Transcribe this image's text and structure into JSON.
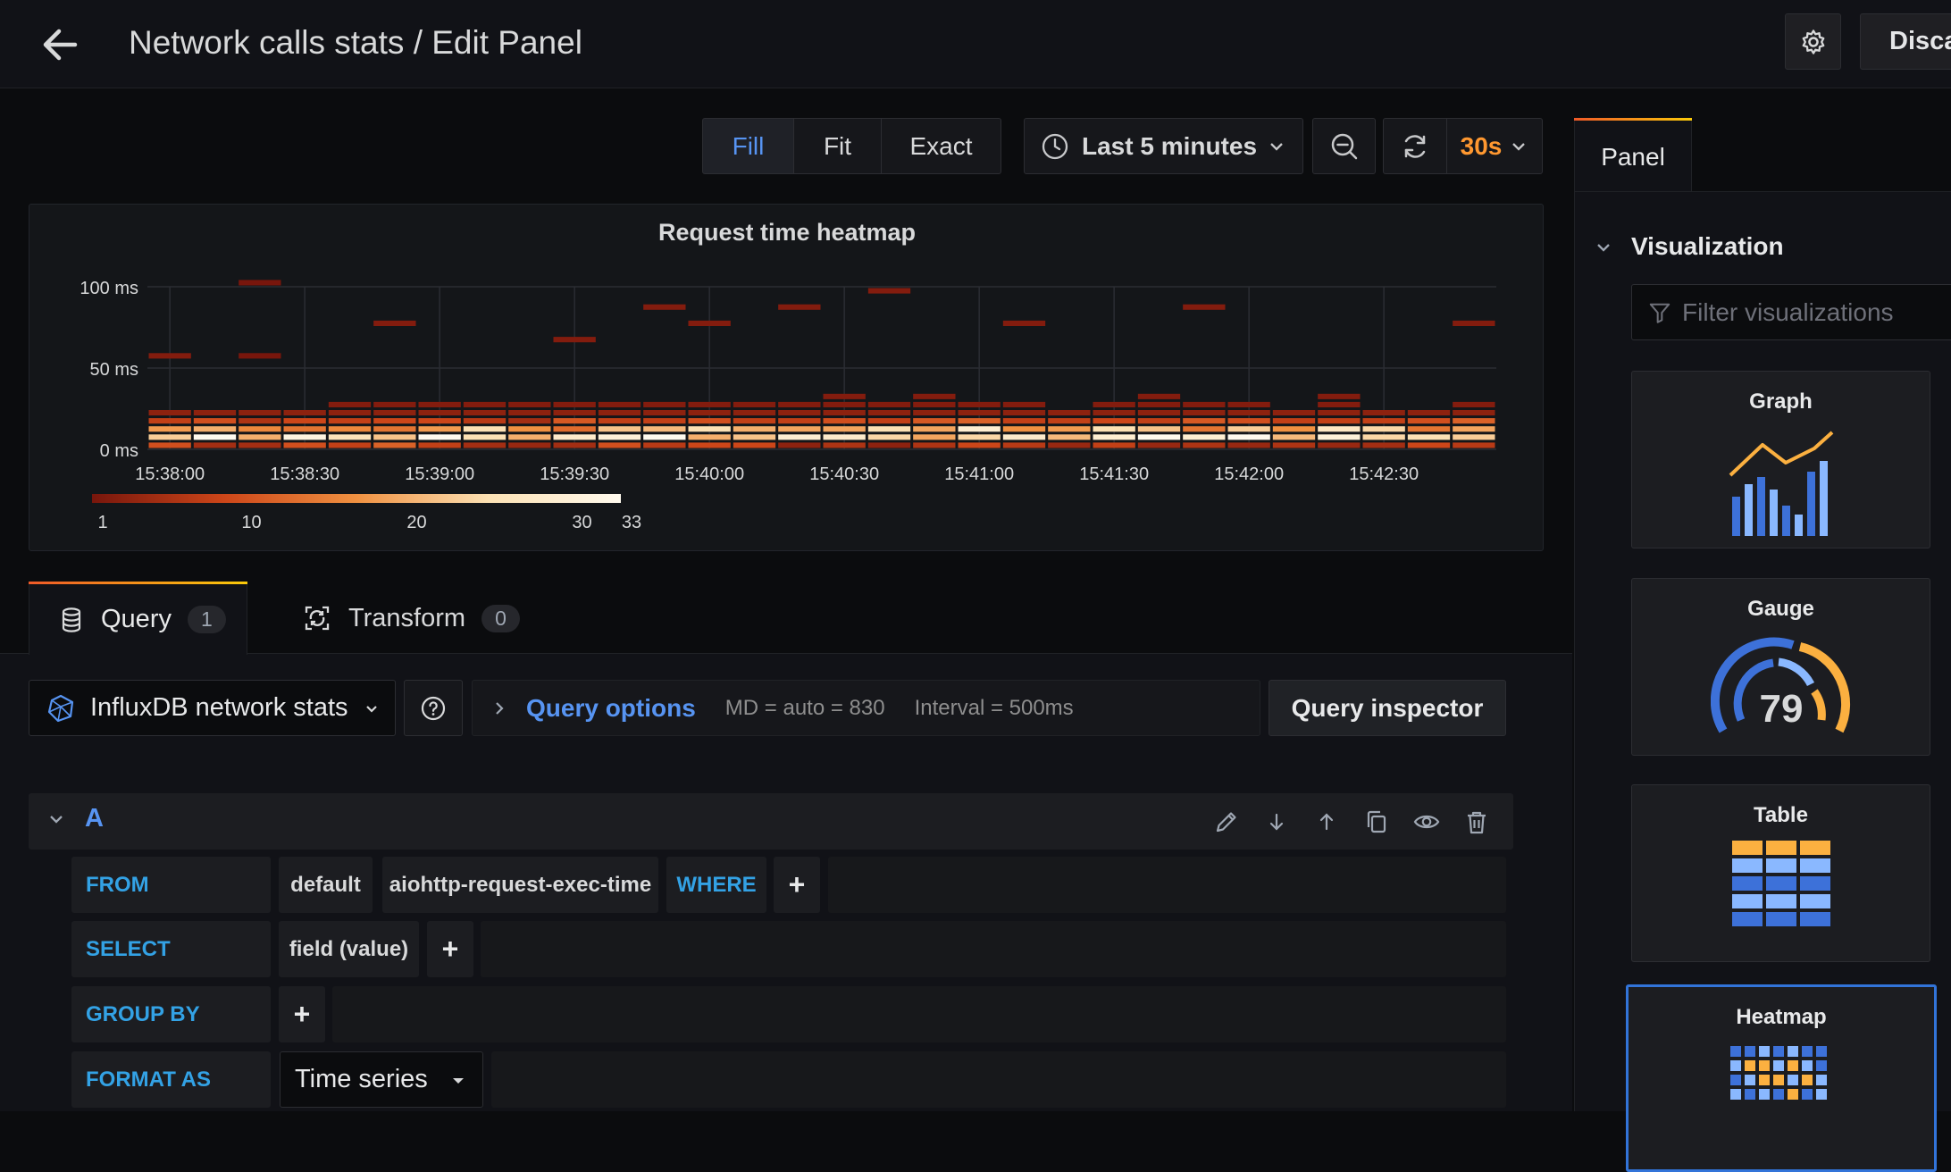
{
  "header": {
    "title": "Network calls stats / Edit Panel",
    "discard_label": "Disca"
  },
  "toolbar": {
    "fill": "Fill",
    "fit": "Fit",
    "exact": "Exact",
    "time_range": "Last 5 minutes",
    "refresh_interval": "30s"
  },
  "chart_data": {
    "type": "heatmap",
    "title": "Request time heatmap",
    "y_ticks": [
      "100 ms",
      "50 ms",
      "0 ms"
    ],
    "x_ticks": [
      "15:38:00",
      "15:38:30",
      "15:39:00",
      "15:39:30",
      "15:40:00",
      "15:40:30",
      "15:41:00",
      "15:41:30",
      "15:42:00",
      "15:42:30"
    ],
    "legend_ticks": [
      "1",
      "10",
      "20",
      "30",
      "33"
    ],
    "color_range": [
      1,
      33
    ],
    "bucket_size_ms": 5,
    "columns": [
      {
        "buckets": {
          "0": 10,
          "1": 23,
          "2": 18,
          "3": 8,
          "4": 3,
          "11": 2
        }
      },
      {
        "buckets": {
          "0": 5,
          "1": 33,
          "2": 20,
          "3": 10,
          "4": 3
        }
      },
      {
        "buckets": {
          "0": 5,
          "1": 20,
          "2": 16,
          "3": 6,
          "4": 3,
          "11": 1,
          "20": 1
        }
      },
      {
        "buckets": {
          "0": 10,
          "1": 31,
          "2": 14,
          "3": 9,
          "4": 3
        }
      },
      {
        "buckets": {
          "0": 8,
          "1": 26,
          "2": 16,
          "3": 8,
          "4": 3,
          "5": 2
        }
      },
      {
        "buckets": {
          "0": 12,
          "1": 22,
          "2": 14,
          "3": 9,
          "4": 3,
          "5": 2,
          "15": 2
        }
      },
      {
        "buckets": {
          "0": 8,
          "1": 33,
          "2": 18,
          "3": 9,
          "4": 3,
          "5": 2
        }
      },
      {
        "buckets": {
          "0": 5,
          "1": 25,
          "2": 25,
          "3": 7,
          "4": 3,
          "5": 2
        }
      },
      {
        "buckets": {
          "0": 4,
          "1": 20,
          "2": 17,
          "3": 5,
          "4": 3,
          "5": 2
        }
      },
      {
        "buckets": {
          "0": 5,
          "1": 28,
          "2": 13,
          "3": 11,
          "4": 3,
          "5": 2,
          "13": 2
        }
      },
      {
        "buckets": {
          "0": 10,
          "1": 30,
          "2": 22,
          "3": 8,
          "4": 3,
          "5": 2
        }
      },
      {
        "buckets": {
          "0": 7,
          "1": 33,
          "2": 21,
          "3": 8,
          "4": 3,
          "5": 2,
          "17": 2
        }
      },
      {
        "buckets": {
          "0": 9,
          "1": 20,
          "2": 25,
          "3": 10,
          "4": 3,
          "5": 2,
          "15": 2
        }
      },
      {
        "buckets": {
          "0": 9,
          "1": 22,
          "2": 20,
          "3": 8,
          "4": 3,
          "5": 2
        }
      },
      {
        "buckets": {
          "0": 3,
          "1": 29,
          "2": 19,
          "3": 8,
          "4": 3,
          "5": 2,
          "17": 2
        }
      },
      {
        "buckets": {
          "0": 6,
          "1": 28,
          "2": 19,
          "3": 10,
          "4": 3,
          "5": 2,
          "6": 2
        }
      },
      {
        "buckets": {
          "0": 3,
          "1": 24,
          "2": 25,
          "3": 8,
          "4": 3,
          "5": 2,
          "19": 2
        }
      },
      {
        "buckets": {
          "0": 6,
          "1": 19,
          "2": 19,
          "3": 11,
          "4": 3,
          "5": 2,
          "6": 2
        }
      },
      {
        "buckets": {
          "0": 9,
          "1": 24,
          "2": 29,
          "3": 12,
          "4": 3,
          "5": 2
        }
      },
      {
        "buckets": {
          "0": 7,
          "1": 28,
          "2": 17,
          "3": 8,
          "4": 3,
          "5": 2,
          "15": 2
        }
      },
      {
        "buckets": {
          "0": 4,
          "1": 21,
          "2": 18,
          "3": 8,
          "4": 3
        }
      },
      {
        "buckets": {
          "0": 8,
          "1": 29,
          "2": 25,
          "3": 9,
          "4": 3,
          "5": 2
        }
      },
      {
        "buckets": {
          "0": 4,
          "1": 33,
          "2": 22,
          "3": 8,
          "4": 3,
          "5": 2,
          "6": 2
        }
      },
      {
        "buckets": {
          "0": 6,
          "1": 29,
          "2": 14,
          "3": 11,
          "4": 3,
          "5": 2,
          "17": 2
        }
      },
      {
        "buckets": {
          "0": 4,
          "1": 33,
          "2": 23,
          "3": 10,
          "4": 3,
          "5": 2
        }
      },
      {
        "buckets": {
          "0": 6,
          "1": 21,
          "2": 17,
          "3": 8,
          "4": 3
        }
      },
      {
        "buckets": {
          "0": 4,
          "1": 30,
          "2": 27,
          "3": 8,
          "4": 3,
          "5": 2,
          "6": 2
        }
      },
      {
        "buckets": {
          "0": 5,
          "1": 24,
          "2": 24,
          "3": 8,
          "4": 3
        }
      },
      {
        "buckets": {
          "0": 9,
          "1": 25,
          "2": 14,
          "3": 10,
          "4": 3
        }
      },
      {
        "buckets": {
          "0": 7,
          "1": 23,
          "2": 19,
          "3": 12,
          "4": 3,
          "5": 2,
          "15": 2
        }
      }
    ]
  },
  "query_tabs": [
    {
      "label": "Query",
      "count": "1"
    },
    {
      "label": "Transform",
      "count": "0"
    }
  ],
  "datasource": {
    "name": "InfluxDB network stats"
  },
  "query_options": {
    "label": "Query options",
    "max_data_points": "MD = auto = 830",
    "interval": "Interval = 500ms"
  },
  "query_inspector_label": "Query inspector",
  "query_a": {
    "ref_id": "A",
    "from_label": "FROM",
    "from_policy": "default",
    "from_measurement": "aiohttp-request-exec-time",
    "where_label": "WHERE",
    "select_label": "SELECT",
    "select_field": "field (value)",
    "group_by_label": "GROUP BY",
    "format_as_label": "FORMAT AS",
    "format_as_value": "Time series"
  },
  "options_pane": {
    "tab": "Panel",
    "section": "Visualization",
    "filter_placeholder": "Filter visualizations",
    "gauge_value": "79",
    "visualizations": [
      "Graph",
      "Gauge",
      "Table",
      "Heatmap"
    ]
  }
}
